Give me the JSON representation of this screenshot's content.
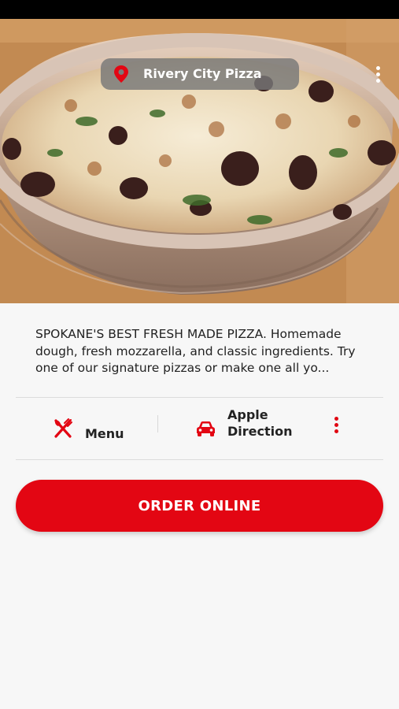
{
  "header": {
    "location_name": "Rivery City Pizza"
  },
  "about": {
    "description": "SPOKANE'S BEST FRESH MADE PIZZA. Homemade dough, fresh mozzarella, and classic ingredients. Try one of our signature pizzas or make one all yo..."
  },
  "actions": {
    "menu_label": "Menu",
    "direction_line1": "Apple",
    "direction_line2": "Direction"
  },
  "order": {
    "button_label": "ORDER ONLINE"
  },
  "colors": {
    "accent": "#e30613",
    "background": "#f7f7f7"
  },
  "icons": [
    "location-pin-icon",
    "more-vertical-icon",
    "fork-knife-icon",
    "car-icon"
  ]
}
